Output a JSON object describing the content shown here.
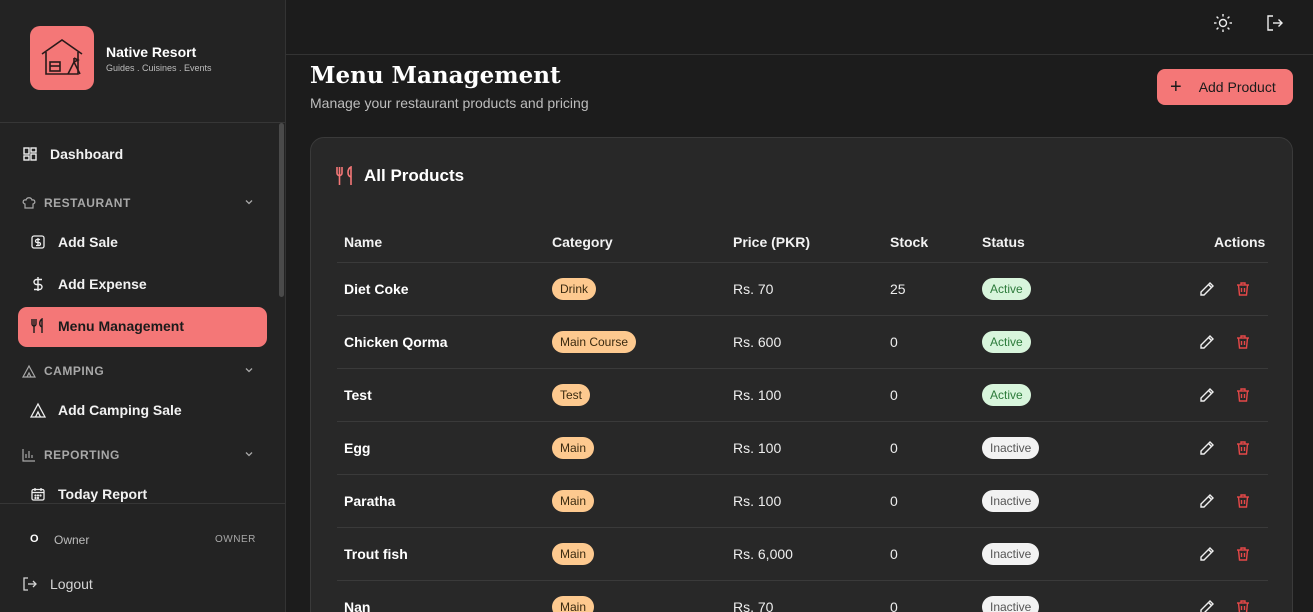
{
  "brand": {
    "name": "Native Resort",
    "tagline": "Guides . Cuisines . Events"
  },
  "sidebar": {
    "dashboard": "Dashboard",
    "restaurant_section": "RESTAURANT",
    "add_sale": "Add Sale",
    "add_expense": "Add Expense",
    "menu_management": "Menu Management",
    "camping_section": "CAMPING",
    "add_camping_sale": "Add Camping Sale",
    "reporting_section": "REPORTING",
    "today_report": "Today Report"
  },
  "user": {
    "initial": "O",
    "name": "Owner",
    "role": "OWNER"
  },
  "logout": "Logout",
  "page": {
    "title": "Menu Management",
    "subtitle": "Manage your restaurant products and pricing",
    "add_button": "Add Product",
    "card_title": "All Products"
  },
  "table": {
    "headers": [
      "Name",
      "Category",
      "Price (PKR)",
      "Stock",
      "Status",
      "Actions"
    ],
    "rows": [
      {
        "name": "Diet Coke",
        "category": "Drink",
        "price": "Rs. 70",
        "stock": "25",
        "status": "Active"
      },
      {
        "name": "Chicken Qorma",
        "category": "Main Course",
        "price": "Rs. 600",
        "stock": "0",
        "status": "Active"
      },
      {
        "name": "Test",
        "category": "Test",
        "price": "Rs. 100",
        "stock": "0",
        "status": "Active"
      },
      {
        "name": "Egg",
        "category": "Main",
        "price": "Rs. 100",
        "stock": "0",
        "status": "Inactive"
      },
      {
        "name": "Paratha",
        "category": "Main",
        "price": "Rs. 100",
        "stock": "0",
        "status": "Inactive"
      },
      {
        "name": "Trout fish",
        "category": "Main",
        "price": "Rs. 6,000",
        "stock": "0",
        "status": "Inactive"
      },
      {
        "name": "Nan",
        "category": "Main",
        "price": "Rs. 70",
        "stock": "0",
        "status": "Inactive"
      }
    ]
  },
  "colors": {
    "accent": "#f47777",
    "background": "#1c1c1c",
    "panel": "#282828"
  },
  "icons": [
    "resort-logo-icon",
    "grid-icon",
    "chef-hat-icon",
    "dollar-box-icon",
    "dollar-icon",
    "utensils-icon",
    "tent-icon",
    "bar-chart-icon",
    "calendar-icon",
    "logout-icon",
    "sun-icon",
    "pencil-icon",
    "trash-icon",
    "chevron-down-icon"
  ]
}
